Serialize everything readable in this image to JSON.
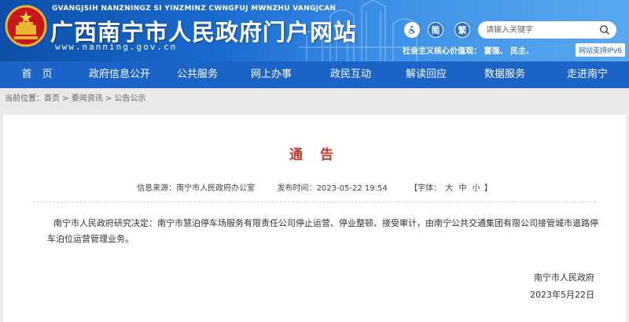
{
  "header": {
    "pinyin": "GVANGJSIH NANZNINGZ SI YINZMINZ CWNGFUJ MWNZHU VANGJCAN",
    "title": "广西南宁市人民政府门户网站",
    "url": "www.nanning.gov.cn",
    "accessibility_icon": "wheelchair-icon",
    "simplified_label": "简",
    "traditional_label": "繁",
    "search_placeholder": "请输入关键字",
    "values_text": "社会主义核心价值观：  富强、  民主、",
    "ipv6_label": "网站支持IPv6",
    "accent": "#1b63c6"
  },
  "nav": {
    "items": [
      {
        "label": "首　页"
      },
      {
        "label": "政府信息公开"
      },
      {
        "label": "公共服务"
      },
      {
        "label": "网上办事"
      },
      {
        "label": "政民互动"
      },
      {
        "label": "解读回应"
      },
      {
        "label": "数据服务"
      },
      {
        "label": "走进南宁"
      }
    ]
  },
  "breadcrumb": {
    "prefix": "当前位置：",
    "items": [
      "首页",
      "要闻资讯",
      "公告公示"
    ],
    "separator": " > "
  },
  "article": {
    "title": "通 告",
    "title_color": "#c0392b",
    "source_label": "信息来源：",
    "source": "南宁市人民政府办公室",
    "time_label": "发布时间：",
    "time": "2023-05-22 19:54",
    "font_label": "【字体：",
    "font_large": "大",
    "font_medium": "中",
    "font_small": "小",
    "font_end": "】",
    "body": "南宁市人民政府研究决定：南宁市慧泊停车场服务有限责任公司停止运营、停业整顿、接受审计，由南宁公共交通集团有限公司接管城市道路停车泊位运营管理业务。",
    "sign_org": "南宁市人民政府",
    "sign_date": "2023年5月22日"
  }
}
